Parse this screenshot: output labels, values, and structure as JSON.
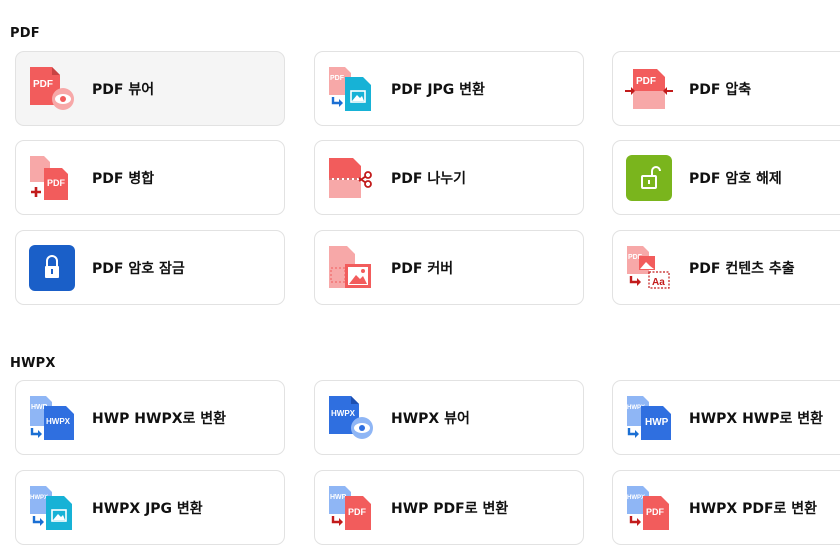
{
  "sections": [
    {
      "title": "PDF",
      "cards": [
        {
          "label": "PDF 뷰어",
          "icon": "pdf-viewer-icon"
        },
        {
          "label": "PDF JPG 변환",
          "icon": "pdf-to-jpg-icon"
        },
        {
          "label": "PDF 압축",
          "icon": "pdf-compress-icon"
        },
        {
          "label": "PDF 병합",
          "icon": "pdf-merge-icon"
        },
        {
          "label": "PDF 나누기",
          "icon": "pdf-split-icon"
        },
        {
          "label": "PDF 암호 해제",
          "icon": "pdf-unlock-icon"
        },
        {
          "label": "PDF 암호 잠금",
          "icon": "pdf-lock-icon"
        },
        {
          "label": "PDF 커버",
          "icon": "pdf-cover-icon"
        },
        {
          "label": "PDF 컨텐츠 추출",
          "icon": "pdf-extract-content-icon"
        }
      ]
    },
    {
      "title": "HWPX",
      "cards": [
        {
          "label": "HWP HWPX로 변환",
          "icon": "hwp-to-hwpx-icon"
        },
        {
          "label": "HWPX 뷰어",
          "icon": "hwpx-viewer-icon"
        },
        {
          "label": "HWPX HWP로 변환",
          "icon": "hwpx-to-hwp-icon"
        },
        {
          "label": "HWPX JPG 변환",
          "icon": "hwpx-to-jpg-icon"
        },
        {
          "label": "HWP PDF로 변환",
          "icon": "hwp-to-pdf-icon"
        },
        {
          "label": "HWPX PDF로 변환",
          "icon": "hwpx-to-pdf-icon"
        }
      ]
    }
  ],
  "icon_text": {
    "pdf": "PDF",
    "hwp": "HWP",
    "hwpx": "HWPX",
    "aa": "Aa"
  },
  "colors": {
    "pdf_red": "#f25c5c",
    "pdf_light": "#f7a8a8",
    "hwp_blue": "#2f6fe0",
    "hwp_light": "#8fb6f5",
    "jpg_teal": "#17b2d6",
    "unlock_green": "#7ab51d",
    "lock_blue": "#1a5fc8",
    "arrow_blue": "#1b6fd3",
    "dark_red": "#c21b1b"
  }
}
